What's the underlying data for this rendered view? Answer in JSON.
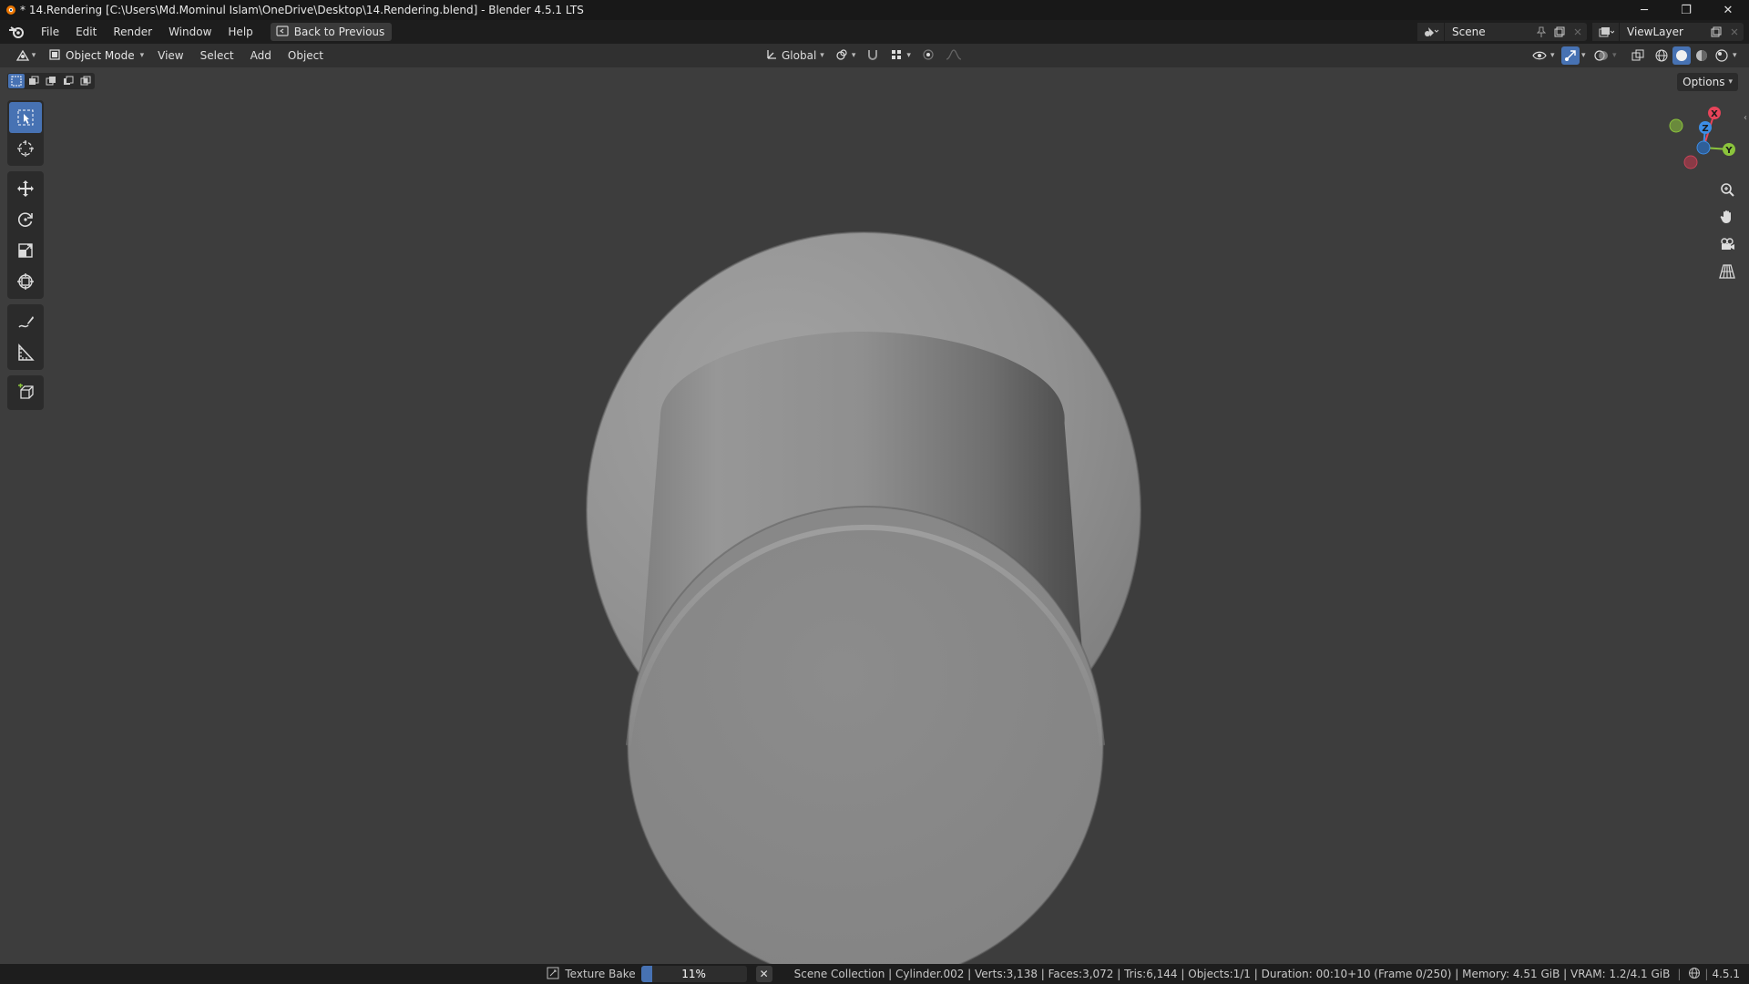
{
  "window": {
    "title": "* 14.Rendering [C:\\Users\\Md.Mominul Islam\\OneDrive\\Desktop\\14.Rendering.blend] - Blender 4.5.1 LTS",
    "minimize_glyph": "─",
    "maximize_glyph": "❐",
    "close_glyph": "✕"
  },
  "menubar": {
    "items": [
      "File",
      "Edit",
      "Render",
      "Window",
      "Help"
    ],
    "back_button": "Back to Previous",
    "scene_name": "Scene",
    "view_layer_name": "ViewLayer"
  },
  "viewport_header": {
    "mode": "Object Mode",
    "menus": [
      "View",
      "Select",
      "Add",
      "Object"
    ],
    "transform_orientation": "Global"
  },
  "viewport": {
    "options_label": "Options",
    "gizmo_axes": {
      "x": "X",
      "y": "Y",
      "z": "Z"
    },
    "tools": [
      "select-box",
      "cursor",
      "move",
      "rotate",
      "scale",
      "transform",
      "annotate",
      "measure",
      "add-cube"
    ],
    "colors": {
      "background": "#3d3d3d",
      "accent": "#4772b3",
      "object": "#8a8a8a",
      "axis_x": "#e8445a",
      "axis_y": "#8bc43c",
      "axis_z": "#3d8ee6"
    }
  },
  "statusbar": {
    "job_name": "Texture Bake",
    "progress_value": 11,
    "progress_label": "11%",
    "stats": "Scene Collection | Cylinder.002 | Verts:3,138 | Faces:3,072 | Tris:6,144 | Objects:1/1 | Duration: 00:10+10 (Frame 0/250) | Memory: 4.51 GiB | VRAM: 1.2/4.1 GiB",
    "version": "4.5.1"
  }
}
